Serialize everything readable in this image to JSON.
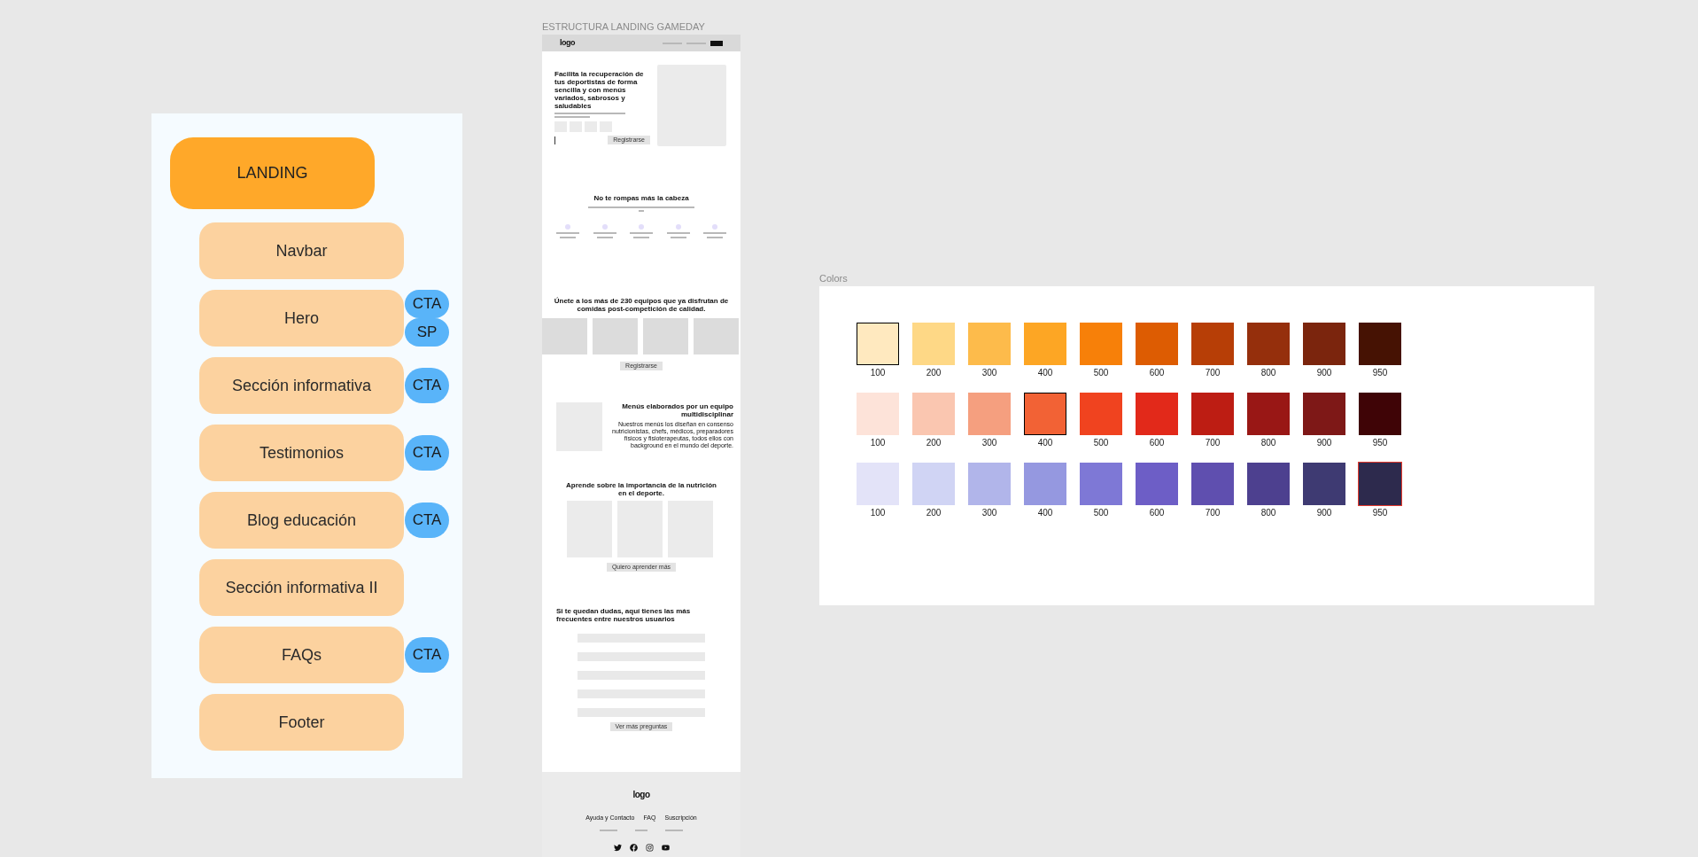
{
  "structure_panel": {
    "root": {
      "label": "LANDING"
    },
    "sections": [
      {
        "label": "Navbar"
      },
      {
        "label": "Hero",
        "tags": [
          "CTA",
          "SP"
        ]
      },
      {
        "label": "Sección informativa",
        "tags": [
          "CTA"
        ]
      },
      {
        "label": "Testimonios",
        "tags": [
          "CTA"
        ]
      },
      {
        "label": "Blog educación",
        "tags": [
          "CTA"
        ]
      },
      {
        "label": "Sección informativa II"
      },
      {
        "label": "FAQs",
        "tags": [
          "CTA"
        ]
      },
      {
        "label": "Footer"
      }
    ]
  },
  "wireframe": {
    "title": "ESTRUCTURA LANDING GAMEDAY",
    "navbar": {
      "logo": "logo"
    },
    "hero": {
      "heading": "Facilita la recuperación de tus deportistas de forma sencilla y con menús variados, sabrosos y saludables",
      "button": "Registrarse"
    },
    "features": {
      "heading": "No te rompas más la cabeza"
    },
    "join": {
      "heading": "Únete a los más de 230 equipos que ya disfrutan de comidas post-competición de calidad.",
      "button": "Registrarse"
    },
    "info": {
      "heading": "Menús elaborados por un equipo multidisciplinar",
      "body": "Nuestros menús los diseñan en consenso nutricionistas, chefs, médicos, preparadores físicos y fisioterapeutas, todos ellos con background en el mundo del deporte."
    },
    "blog": {
      "heading": "Aprende sobre la importancia de la nutrición en el deporte.",
      "button": "Quiero aprender más"
    },
    "faq": {
      "heading": "Si te quedan dudas, aquí tienes las más frecuentes entre nuestros usuarios",
      "button": "Ver más preguntas"
    },
    "footer": {
      "logo": "logo",
      "links": [
        "Ayuda y Contacto",
        "FAQ",
        "Suscripción"
      ]
    }
  },
  "colors_panel": {
    "title": "Colors",
    "palettes": [
      {
        "swatches": [
          {
            "label": "100",
            "color": "#ffe9bf",
            "selected": true,
            "hovered": false
          },
          {
            "label": "200",
            "color": "#fed886",
            "selected": false,
            "hovered": false
          },
          {
            "label": "300",
            "color": "#fdbb4b",
            "selected": false,
            "hovered": false
          },
          {
            "label": "400",
            "color": "#fda624",
            "selected": false,
            "hovered": false
          },
          {
            "label": "500",
            "color": "#f78009",
            "selected": false,
            "hovered": false
          },
          {
            "label": "600",
            "color": "#dd5c02",
            "selected": false,
            "hovered": false
          },
          {
            "label": "700",
            "color": "#b73e06",
            "selected": false,
            "hovered": false
          },
          {
            "label": "800",
            "color": "#952f0c",
            "selected": false,
            "hovered": false
          },
          {
            "label": "900",
            "color": "#7b250d",
            "selected": false,
            "hovered": false
          },
          {
            "label": "950",
            "color": "#461203",
            "selected": false,
            "hovered": false
          }
        ]
      },
      {
        "swatches": [
          {
            "label": "100",
            "color": "#fde3d9",
            "selected": false,
            "hovered": false
          },
          {
            "label": "200",
            "color": "#fac6b0",
            "selected": false,
            "hovered": false
          },
          {
            "label": "300",
            "color": "#f59f7f",
            "selected": false,
            "hovered": false
          },
          {
            "label": "400",
            "color": "#f26235",
            "selected": true,
            "hovered": false
          },
          {
            "label": "500",
            "color": "#f0431f",
            "selected": false,
            "hovered": false
          },
          {
            "label": "600",
            "color": "#e2291a",
            "selected": false,
            "hovered": false
          },
          {
            "label": "700",
            "color": "#bd1d13",
            "selected": false,
            "hovered": false
          },
          {
            "label": "800",
            "color": "#991715",
            "selected": false,
            "hovered": false
          },
          {
            "label": "900",
            "color": "#7e1817",
            "selected": false,
            "hovered": false
          },
          {
            "label": "950",
            "color": "#3f0406",
            "selected": false,
            "hovered": false
          }
        ]
      },
      {
        "swatches": [
          {
            "label": "100",
            "color": "#e3e3f8",
            "selected": false,
            "hovered": false
          },
          {
            "label": "200",
            "color": "#d0d4f4",
            "selected": false,
            "hovered": false
          },
          {
            "label": "300",
            "color": "#b1b5ea",
            "selected": false,
            "hovered": false
          },
          {
            "label": "400",
            "color": "#9598e0",
            "selected": false,
            "hovered": false
          },
          {
            "label": "500",
            "color": "#7e78d6",
            "selected": false,
            "hovered": false
          },
          {
            "label": "600",
            "color": "#6d5ec6",
            "selected": false,
            "hovered": false
          },
          {
            "label": "700",
            "color": "#5f4faf",
            "selected": false,
            "hovered": false
          },
          {
            "label": "800",
            "color": "#4d408f",
            "selected": false,
            "hovered": false
          },
          {
            "label": "900",
            "color": "#3e3a72",
            "selected": false,
            "hovered": false
          },
          {
            "label": "950",
            "color": "#2d2a4d",
            "selected": false,
            "hovered": true
          }
        ]
      }
    ]
  }
}
